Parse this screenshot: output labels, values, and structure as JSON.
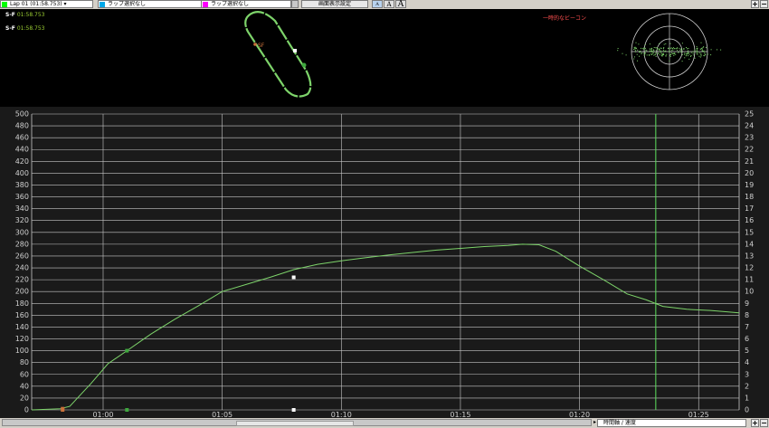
{
  "toolbar": {
    "lap1": {
      "text": "Lap 01   (01:58.753) ▾",
      "color": "#00ff00"
    },
    "lap2": {
      "text": "ラップ選択なし",
      "color": "#00a8e8"
    },
    "lap3": {
      "text": "ラップ選択なし",
      "color": "#ff00ff"
    },
    "display_settings": "画面表示設定",
    "font_small": "A",
    "font_medium": "A",
    "font_large": "A",
    "add": "+",
    "remove": "−"
  },
  "map": {
    "sf_time_1_label": "S-F",
    "sf_time_1": "01:58.753",
    "sf_time_2_label": "S-F",
    "sf_time_2": "01:58.753",
    "sf_marker": "SF",
    "beacon_label": "一時的なビーコン"
  },
  "bottom": {
    "axis_label": "時間軸 / 速度",
    "add": "+",
    "remove": "−"
  },
  "colors": {
    "trace": "#7dd36a",
    "grid": "#c8c8c8",
    "cursor": "#5ee05e",
    "beacon": "#ff5050"
  },
  "chart_data": {
    "type": "line",
    "x_ticks": [
      "01:00",
      "01:05",
      "01:10",
      "01:15",
      "01:20",
      "01:25"
    ],
    "x_tick_seconds": [
      60,
      65,
      70,
      75,
      80,
      85
    ],
    "xlim": [
      57,
      86.7
    ],
    "y_left": {
      "ticks": [
        0,
        20,
        40,
        60,
        80,
        100,
        120,
        140,
        160,
        180,
        200,
        220,
        240,
        260,
        280,
        300,
        320,
        340,
        360,
        380,
        400,
        420,
        440,
        460,
        480,
        500
      ],
      "lim": [
        0,
        500
      ]
    },
    "y_right": {
      "ticks": [
        0,
        1,
        2,
        3,
        4,
        5,
        6,
        7,
        8,
        9,
        10,
        11,
        12,
        13,
        14,
        15,
        16,
        17,
        18,
        19,
        20,
        21,
        22,
        23,
        24,
        25
      ],
      "lim": [
        0,
        25
      ]
    },
    "series": [
      {
        "x": [
          57.0,
          58.2,
          58.6,
          59.5,
          60.2,
          61.0,
          62.0,
          63.0,
          64.0,
          65.0,
          66.0,
          67.0,
          68.0,
          69.0,
          70.0,
          71.0,
          72.0,
          73.0,
          74.0,
          75.0,
          76.0,
          77.0,
          77.6,
          78.3,
          79.0,
          80.0,
          81.0,
          82.0,
          82.8,
          83.5,
          84.5,
          85.5,
          86.7
        ],
        "y": [
          0,
          2,
          6,
          45,
          78,
          100,
          128,
          153,
          176,
          200,
          212,
          224,
          237,
          246,
          252,
          257,
          262,
          266,
          270,
          273,
          276,
          278,
          280,
          279,
          268,
          243,
          220,
          196,
          186,
          175,
          170,
          168,
          164
        ]
      }
    ],
    "markers": [
      {
        "x": 58.3,
        "y": 2,
        "color": "#c9703a"
      },
      {
        "x": 61.0,
        "y": 100,
        "color": "#3ea83e"
      },
      {
        "x": 68.0,
        "y": 224,
        "color": "#ffffff"
      }
    ],
    "base_markers": [
      {
        "x": 58.3,
        "color": "#c9703a"
      },
      {
        "x": 61.0,
        "color": "#3ea83e"
      },
      {
        "x": 68.0,
        "color": "#ffffff"
      }
    ],
    "cursor_x": 83.2
  }
}
